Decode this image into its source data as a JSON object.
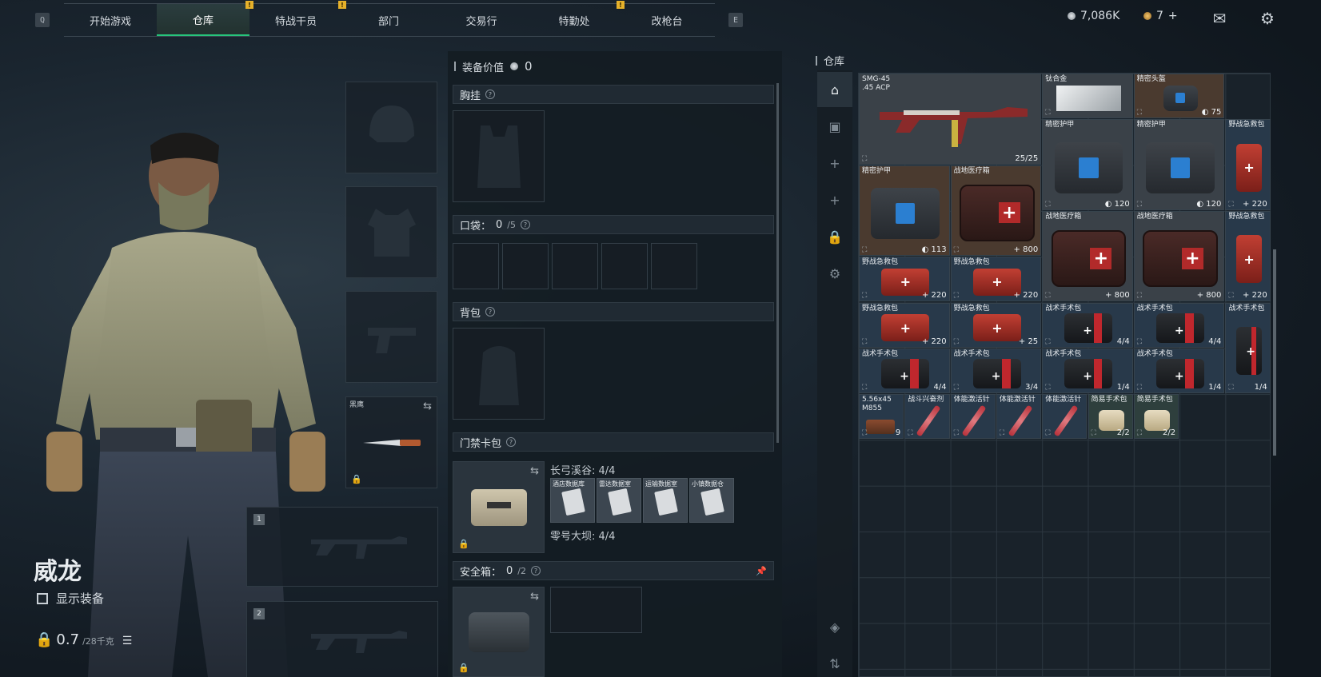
{
  "nav": {
    "left_key": "Q",
    "right_key": "E",
    "tabs": [
      {
        "label": "开始游戏",
        "active": false
      },
      {
        "label": "仓库",
        "active": true
      },
      {
        "label": "特战干员",
        "active": false
      },
      {
        "label": "部门",
        "active": false
      },
      {
        "label": "交易行",
        "active": false
      },
      {
        "label": "特勤处",
        "active": false
      },
      {
        "label": "改枪台",
        "active": false
      }
    ],
    "tab_mark": "!",
    "currency_silver": "7,086K",
    "currency_gold": "7",
    "currency_add": "+"
  },
  "operator": {
    "name": "威龙",
    "show_equipment_label": "显示装备",
    "weight_value": "0.7",
    "weight_max": "/28千克"
  },
  "gear_slots": {
    "melee_name": "黑鹰",
    "weapon_slot_1": "1",
    "weapon_slot_2": "2"
  },
  "loadout": {
    "header": "装备价值",
    "value": "0",
    "chest_rig": "胸挂",
    "pockets": "口袋：",
    "pockets_count": "0",
    "pockets_cap": "/5",
    "backpack": "背包",
    "keycard_case": "门禁卡包",
    "keycard_group_1": "长弓溪谷: 4/4",
    "keycard_group_2": "零号大坝: 4/4",
    "keycards": [
      "酒店数据库",
      "雷达数据室",
      "运输数据室",
      "小镇数据仓"
    ],
    "safe_box": "安全箱：",
    "safe_count": "0",
    "safe_cap": "/2",
    "question": "?"
  },
  "stash": {
    "title": "仓库",
    "items": [
      {
        "name": "SMG-45",
        "sub": ".45 ACP",
        "value": "25/25",
        "kind": "gun"
      },
      {
        "name": "钛合金",
        "value": "",
        "kind": "metal"
      },
      {
        "name": "精密头盔",
        "value": "75",
        "kind": "bag"
      },
      {
        "name": "精密护甲",
        "value": "120",
        "kind": "bag"
      },
      {
        "name": "精密护甲",
        "value": "120",
        "kind": "bag"
      },
      {
        "name": "野战急救包",
        "value": "220",
        "kind": "redkit"
      },
      {
        "name": "精密护甲",
        "value": "113",
        "kind": "bag"
      },
      {
        "name": "战地医疗箱",
        "value": "800",
        "kind": "medbox"
      },
      {
        "name": "战地医疗箱",
        "value": "800",
        "kind": "medbox"
      },
      {
        "name": "战地医疗箱",
        "value": "800",
        "kind": "medbox"
      },
      {
        "name": "野战急救包",
        "value": "220",
        "kind": "redkit"
      },
      {
        "name": "野战急救包",
        "value": "220",
        "kind": "redkit"
      },
      {
        "name": "野战急救包",
        "value": "220",
        "kind": "redkit"
      },
      {
        "name": "野战急救包",
        "value": "220",
        "kind": "redkit"
      },
      {
        "name": "野战急救包",
        "value": "25",
        "kind": "redkit"
      },
      {
        "name": "战术手术包",
        "value": "4/4",
        "kind": "pouch"
      },
      {
        "name": "战术手术包",
        "value": "4/4",
        "kind": "pouch"
      },
      {
        "name": "战术手术包",
        "value": "1/4",
        "kind": "pouch"
      },
      {
        "name": "战术手术包",
        "value": "4/4",
        "kind": "pouch"
      },
      {
        "name": "战术手术包",
        "value": "3/4",
        "kind": "pouch"
      },
      {
        "name": "战术手术包",
        "value": "1/4",
        "kind": "pouch"
      },
      {
        "name": "战术手术包",
        "value": "1/4",
        "kind": "pouch"
      },
      {
        "name": "5.56x45",
        "sub": "M855",
        "value": "9",
        "kind": "ammo"
      },
      {
        "name": "战斗兴奋剂",
        "value": "",
        "kind": "syringe"
      },
      {
        "name": "体能激活针",
        "value": "",
        "kind": "syringe"
      },
      {
        "name": "体能激活针",
        "value": "",
        "kind": "syringe"
      },
      {
        "name": "体能激活针",
        "value": "",
        "kind": "syringe"
      },
      {
        "name": "简易手术包",
        "value": "2/2",
        "kind": "bandage"
      },
      {
        "name": "简易手术包",
        "value": "2/2",
        "kind": "bandage"
      }
    ]
  }
}
